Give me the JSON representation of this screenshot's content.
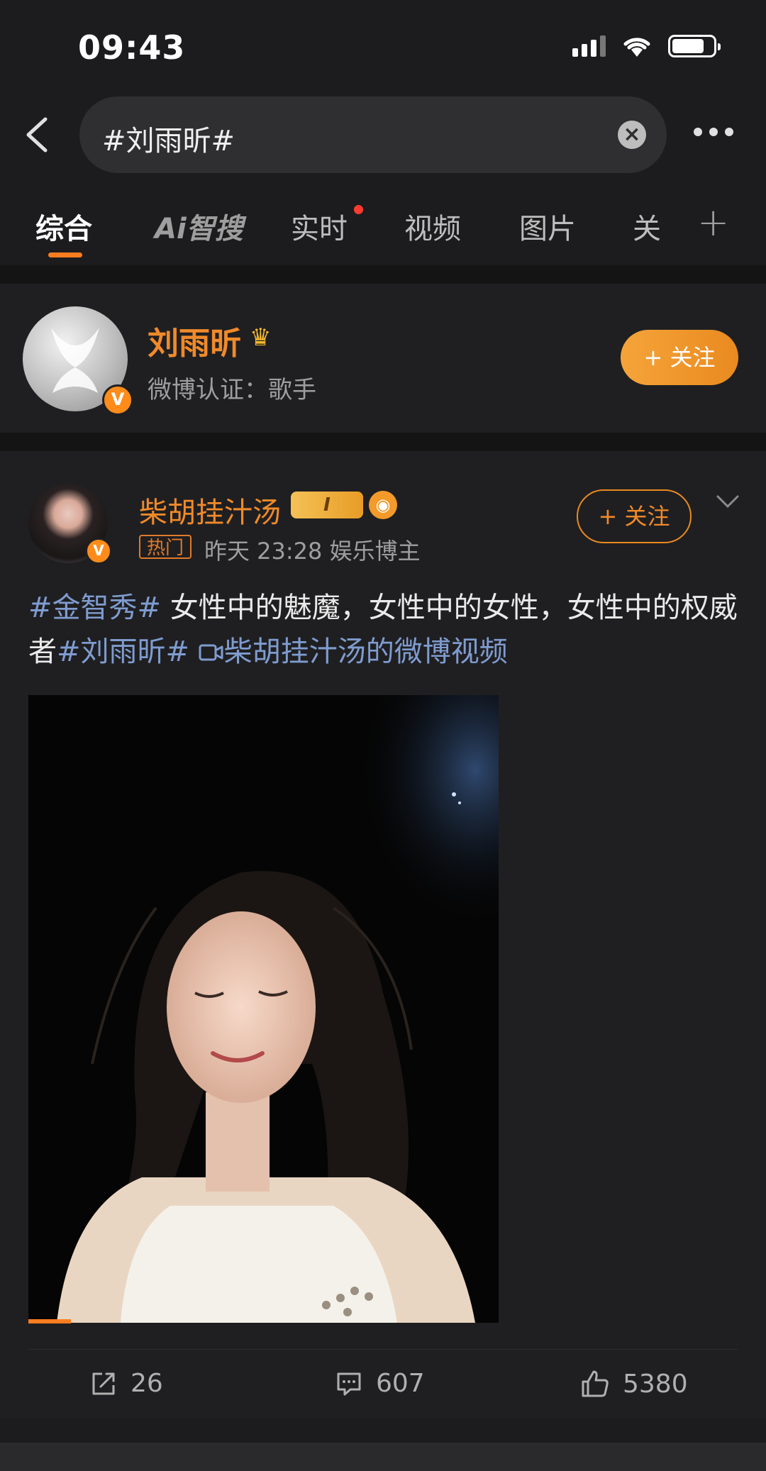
{
  "status_bar": {
    "time": "09:43"
  },
  "search": {
    "query": "#刘雨昕#"
  },
  "tabs": [
    {
      "label": "综合",
      "active": true
    },
    {
      "label": "Ai智搜",
      "active": false
    },
    {
      "label": "实时",
      "active": false,
      "has_dot": true
    },
    {
      "label": "视频",
      "active": false
    },
    {
      "label": "图片",
      "active": false
    },
    {
      "label": "关",
      "active": false
    }
  ],
  "profile": {
    "name": "刘雨昕",
    "verification": "微博认证：歌手",
    "follow_label": "+ 关注"
  },
  "post": {
    "author": "柴胡挂汁汤",
    "level_badge": "I",
    "hot_tag": "热门",
    "meta": "昨天 23:28  娱乐博主",
    "follow_label": "+ 关注",
    "text": {
      "topic1": "#金智秀#",
      "body": " 女性中的魅魔，女性中的女性，女性中的权威者",
      "topic2": "#刘雨昕#",
      "video_link": "柴胡挂汁汤的微博视频"
    },
    "video_progress": 0.09,
    "actions": {
      "reposts": "26",
      "comments": "607",
      "likes": "5380"
    }
  },
  "colors": {
    "accent": "#f08a2a",
    "topic": "#7f9cd0",
    "background": "#1c1c1e"
  }
}
